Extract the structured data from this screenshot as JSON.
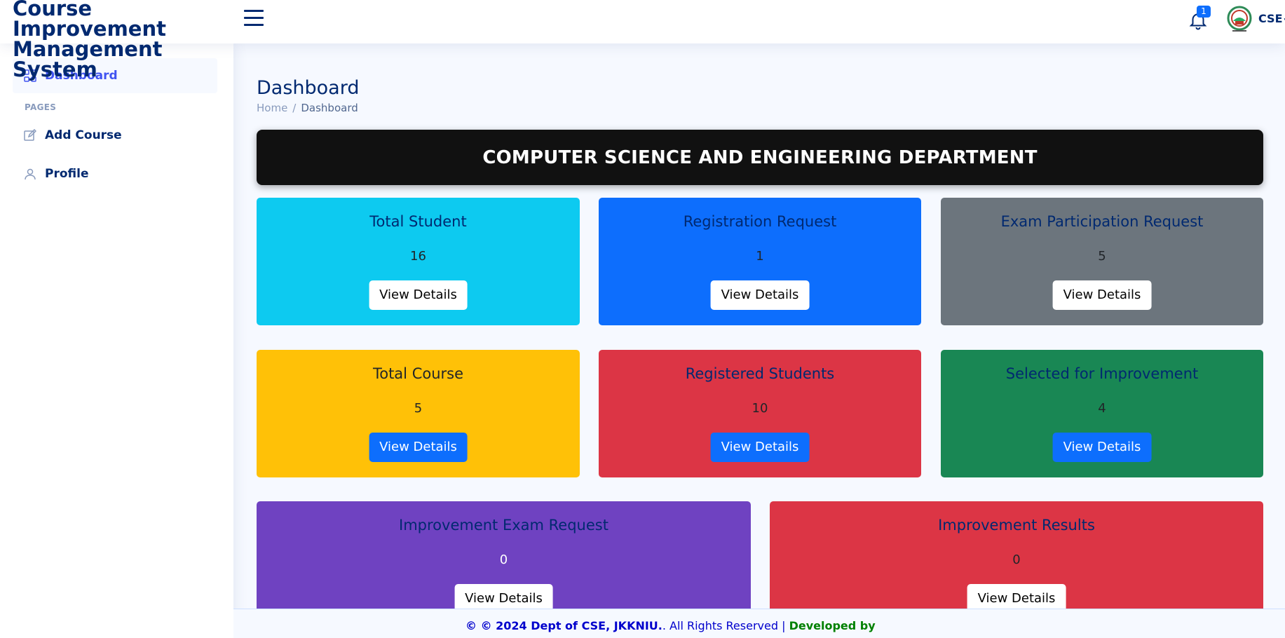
{
  "header": {
    "brand_line1": "Course Improvement",
    "brand_line2": "Management System",
    "notification_count": "1",
    "profile_name": "CSE"
  },
  "sidebar": {
    "items": [
      {
        "label": "Dashboard",
        "icon": "grid-icon"
      },
      {
        "label": "Add Course",
        "icon": "edit-icon"
      },
      {
        "label": "Profile",
        "icon": "person-icon"
      }
    ],
    "heading": "PAGES"
  },
  "main": {
    "title": "Dashboard",
    "breadcrumb": {
      "home": "Home",
      "separator": "/",
      "current": "Dashboard"
    },
    "banner": "COMPUTER SCIENCE AND ENGINEERING DEPARTMENT",
    "cards": [
      {
        "title": "Total Student",
        "value": "16",
        "button": "View Details",
        "bg": "#0dcaf0",
        "title_color": "#012970",
        "value_color": "#212529"
      },
      {
        "title": "Registration Request",
        "value": "1",
        "button": "View Details",
        "bg": "#0d6efd",
        "title_color": "#012970",
        "value_color": "#212529"
      },
      {
        "title": "Exam Participation Request",
        "value": "5",
        "button": "View Details",
        "bg": "#6c757d",
        "title_color": "#012970",
        "value_color": "#212529"
      },
      {
        "title": "Total Course",
        "value": "5",
        "button": "View Details",
        "bg": "#ffc107",
        "title_color": "#212529",
        "value_color": "#212529"
      },
      {
        "title": "Registered Students",
        "value": "10",
        "button": "View Details",
        "bg": "#dc3545",
        "title_color": "#012970",
        "value_color": "#212529"
      },
      {
        "title": "Selected for Improvement",
        "value": "4",
        "button": "View Details",
        "bg": "#198754",
        "title_color": "#012970",
        "value_color": "#212529"
      },
      {
        "title": "Improvement Exam Request",
        "value": "0",
        "button": "View Details",
        "bg": "#6f42c1",
        "title_color": "#012970",
        "value_color": "#ffffff"
      },
      {
        "title": "Improvement Results",
        "value": "0",
        "button": "View Details",
        "bg": "#dc3545",
        "title_color": "#012970",
        "value_color": "#212529"
      }
    ]
  },
  "footer": {
    "copyright": "© © 2024 Dept of CSE, JKKNIU.",
    "rights": ". All Rights Reserved |",
    "developed": "Developed by"
  }
}
